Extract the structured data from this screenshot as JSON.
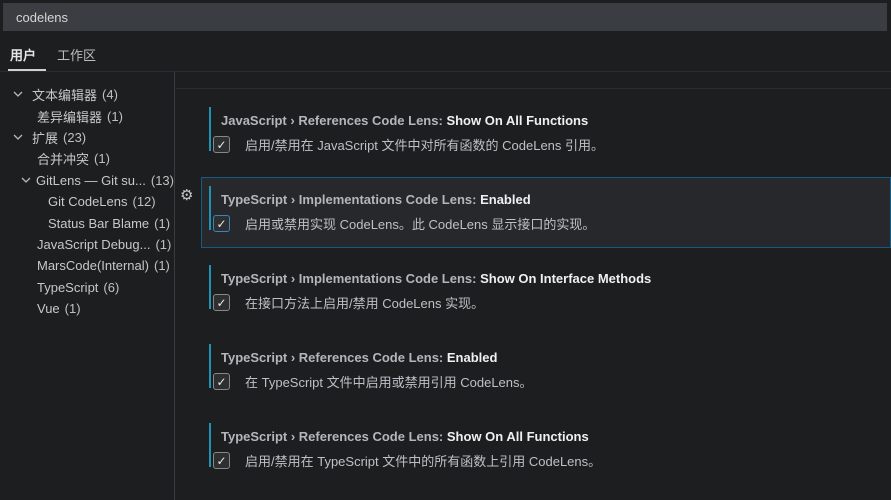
{
  "search": {
    "value": "codelens"
  },
  "tabs": [
    {
      "label": "用户",
      "active": true
    },
    {
      "label": "工作区",
      "active": false
    }
  ],
  "toc": {
    "items": [
      {
        "label": "文本编辑器",
        "count": "(4)",
        "level": 0,
        "chevron": true
      },
      {
        "label": "差异编辑器",
        "count": "(1)",
        "level": 1,
        "chevron": false
      },
      {
        "label": "扩展",
        "count": "(23)",
        "level": 0,
        "chevron": true
      },
      {
        "label": "合并冲突",
        "count": "(1)",
        "level": 1,
        "chevron": false
      },
      {
        "label": "GitLens — Git su...",
        "count": "(13)",
        "level": 1,
        "chevron": true
      },
      {
        "label": "Git CodeLens",
        "count": "(12)",
        "level": 2,
        "chevron": false
      },
      {
        "label": "Status Bar Blame",
        "count": "(1)",
        "level": 2,
        "chevron": false
      },
      {
        "label": "JavaScript Debug...",
        "count": "(1)",
        "level": 1,
        "chevron": false
      },
      {
        "label": "MarsCode(Internal)",
        "count": "(1)",
        "level": 1,
        "chevron": false
      },
      {
        "label": "TypeScript",
        "count": "(6)",
        "level": 1,
        "chevron": false
      },
      {
        "label": "Vue",
        "count": "(1)",
        "level": 1,
        "chevron": false
      }
    ]
  },
  "settings": {
    "rows": [
      {
        "category": "JavaScript › References Code Lens:",
        "name": "Show On All Functions",
        "description": "启用/禁用在 JavaScript 文件中对所有函数的 CodeLens 引用。",
        "checked": true,
        "modified": true,
        "focused": false
      },
      {
        "category": "TypeScript › Implementations Code Lens:",
        "name": "Enabled",
        "description": "启用或禁用实现 CodeLens。此 CodeLens 显示接口的实现。",
        "checked": true,
        "modified": true,
        "focused": true
      },
      {
        "category": "TypeScript › Implementations Code Lens:",
        "name": "Show On Interface Methods",
        "description": "在接口方法上启用/禁用 CodeLens 实现。",
        "checked": true,
        "modified": true,
        "focused": false
      },
      {
        "category": "TypeScript › References Code Lens:",
        "name": "Enabled",
        "description": "在 TypeScript 文件中启用或禁用引用 CodeLens。",
        "checked": true,
        "modified": true,
        "focused": false
      },
      {
        "category": "TypeScript › References Code Lens:",
        "name": "Show On All Functions",
        "description": "启用/禁用在 TypeScript 文件中的所有函数上引用 CodeLens。",
        "checked": true,
        "modified": true,
        "focused": false
      }
    ]
  },
  "icons": {
    "gear": "⚙",
    "check": "✓",
    "chevron_down": "chevron-down"
  },
  "colors": {
    "modified_indicator": "#1f93b5",
    "focus_border": "#175a84",
    "focused_row_bg": "#26282c",
    "background": "#1d1e20",
    "search_bg": "#3a3d41"
  }
}
